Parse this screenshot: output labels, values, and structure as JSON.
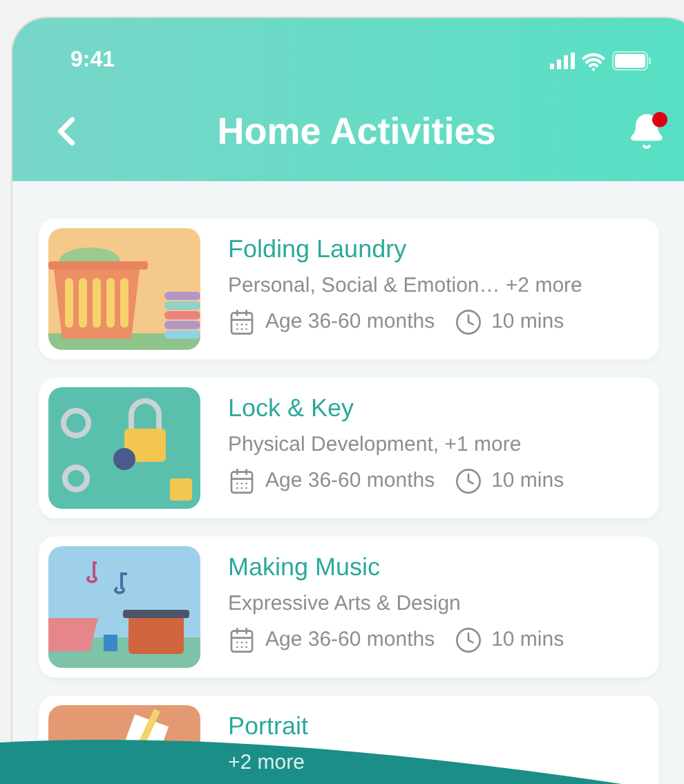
{
  "status_bar": {
    "time": "9:41"
  },
  "header": {
    "title": "Home Activities",
    "notification_dot": true
  },
  "activities": [
    {
      "kind": "laundry",
      "title": "Folding Laundry",
      "areas": "Personal, Social & Emotion… +2 more",
      "age": "Age 36-60 months",
      "duration": "10 mins"
    },
    {
      "kind": "keys",
      "title": "Lock & Key",
      "areas": "Physical Development, +1 more",
      "age": "Age 36-60 months",
      "duration": "10 mins"
    },
    {
      "kind": "music",
      "title": "Making Music",
      "areas": "Expressive Arts & Design",
      "age": "Age 36-60 months",
      "duration": "10 mins"
    },
    {
      "kind": "portrait",
      "title": "Portrait",
      "areas": "+2 more"
    }
  ]
}
